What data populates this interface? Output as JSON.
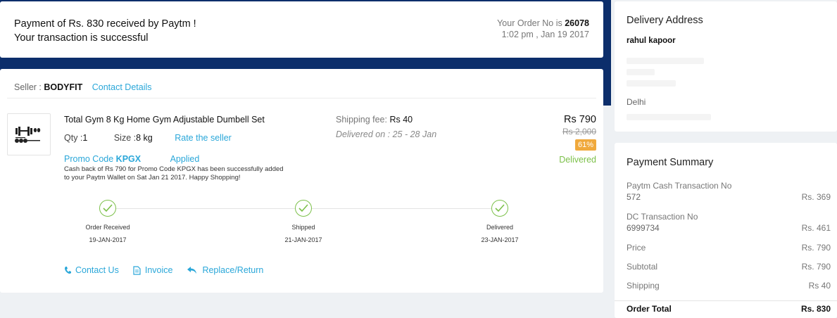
{
  "success": {
    "line1": "Payment of Rs. 830 received by Paytm !",
    "line2": "Your transaction is successful",
    "order_label": "Your Order No is",
    "order_no": "26078",
    "datetime": "1:02 pm , Jan 19 2017"
  },
  "seller": {
    "label": "Seller : ",
    "name": "BODYFIT",
    "contact": "Contact Details"
  },
  "product": {
    "title": "Total Gym 8 Kg Home Gym Adjustable Dumbell Set",
    "qty_label": "Qty :",
    "qty": "1",
    "size_label": "Size :",
    "size": "8 kg",
    "rate_seller": "Rate the seller",
    "promo_label": "Promo Code",
    "promo_code": "KPGX",
    "promo_status": "Applied",
    "cashback": "Cash back of Rs 790 for Promo Code KPGX                      has been successfully added to your Paytm Wallet on Sat Jan 21 2017. Happy Shopping!",
    "shipping_label": "Shipping fee:",
    "shipping_fee": "Rs 40",
    "delivered_on": "Delivered on : 25 - 28 Jan",
    "price": "Rs 790",
    "old_price": "Rs 2,000",
    "discount": "61%",
    "status": "Delivered"
  },
  "tracker": [
    {
      "label": "Order Received",
      "date": "19-JAN-2017"
    },
    {
      "label": "Shipped",
      "date": "21-JAN-2017"
    },
    {
      "label": "Delivered",
      "date": "23-JAN-2017"
    }
  ],
  "actions": {
    "contact": "Contact Us",
    "invoice": "Invoice",
    "replace": "Replace/Return"
  },
  "address": {
    "title": "Delivery Address",
    "name": "rahul kapoor",
    "city": "Delhi"
  },
  "payment": {
    "title": "Payment Summary",
    "rows": [
      {
        "label": "Paytm Cash Transaction No",
        "sub": "572",
        "amount": "Rs. 369"
      },
      {
        "label": "DC Transaction No",
        "sub": "6999734",
        "amount": "Rs. 461"
      },
      {
        "label": "Price",
        "amount": "Rs. 790"
      },
      {
        "label": "Subtotal",
        "amount": "Rs. 790"
      },
      {
        "label": "Shipping",
        "amount": "Rs 40"
      }
    ],
    "total_label": "Order Total",
    "total_amount": "Rs. 830"
  },
  "colors": {
    "accent": "#2aa7d9",
    "success": "#7cc04a",
    "discount_badge": "#f0a93c",
    "header_band": "#0c2e6b"
  }
}
